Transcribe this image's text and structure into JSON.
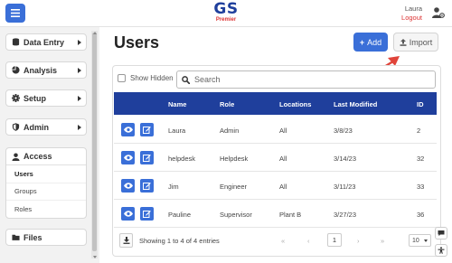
{
  "header": {
    "logo_main": "GS",
    "logo_sub": "Premier",
    "user_name": "Laura",
    "logout_label": "Logout",
    "accent_color": "#3a6fd8",
    "brand_color": "#1f3f9c",
    "menu_icon": "hamburger-icon",
    "user_icon": "user-gear-icon"
  },
  "sidebar": {
    "items": [
      {
        "label": "Data Entry",
        "icon": "database-icon"
      },
      {
        "label": "Analysis",
        "icon": "pie-chart-icon"
      },
      {
        "label": "Setup",
        "icon": "gear-icon"
      },
      {
        "label": "Admin",
        "icon": "shield-icon"
      },
      {
        "label": "Access",
        "icon": "user-icon"
      },
      {
        "label": "Files",
        "icon": "folder-icon"
      }
    ],
    "access_subitems": [
      "Users",
      "Groups",
      "Roles"
    ],
    "active_subitem": "Users"
  },
  "main": {
    "title": "Users",
    "add_label": "Add",
    "import_label": "Import",
    "show_hidden_label": "Show Hidden",
    "search_placeholder": "Search"
  },
  "table": {
    "columns": [
      "Name",
      "Role",
      "Locations",
      "Last Modified",
      "ID"
    ],
    "rows": [
      {
        "name": "Laura",
        "role": "Admin",
        "locations": "All",
        "modified": "3/8/23",
        "id": "2"
      },
      {
        "name": "helpdesk",
        "role": "Helpdesk",
        "locations": "All",
        "modified": "3/14/23",
        "id": "32"
      },
      {
        "name": "Jim",
        "role": "Engineer",
        "locations": "All",
        "modified": "3/11/23",
        "id": "33"
      },
      {
        "name": "Pauline",
        "role": "Supervisor",
        "locations": "Plant B",
        "modified": "3/27/23",
        "id": "36"
      }
    ]
  },
  "pager": {
    "summary": "Showing 1 to 4 of 4 entries",
    "first": "«",
    "prev": "‹",
    "current_page": "1",
    "next": "›",
    "last": "»",
    "per_page": "10"
  }
}
